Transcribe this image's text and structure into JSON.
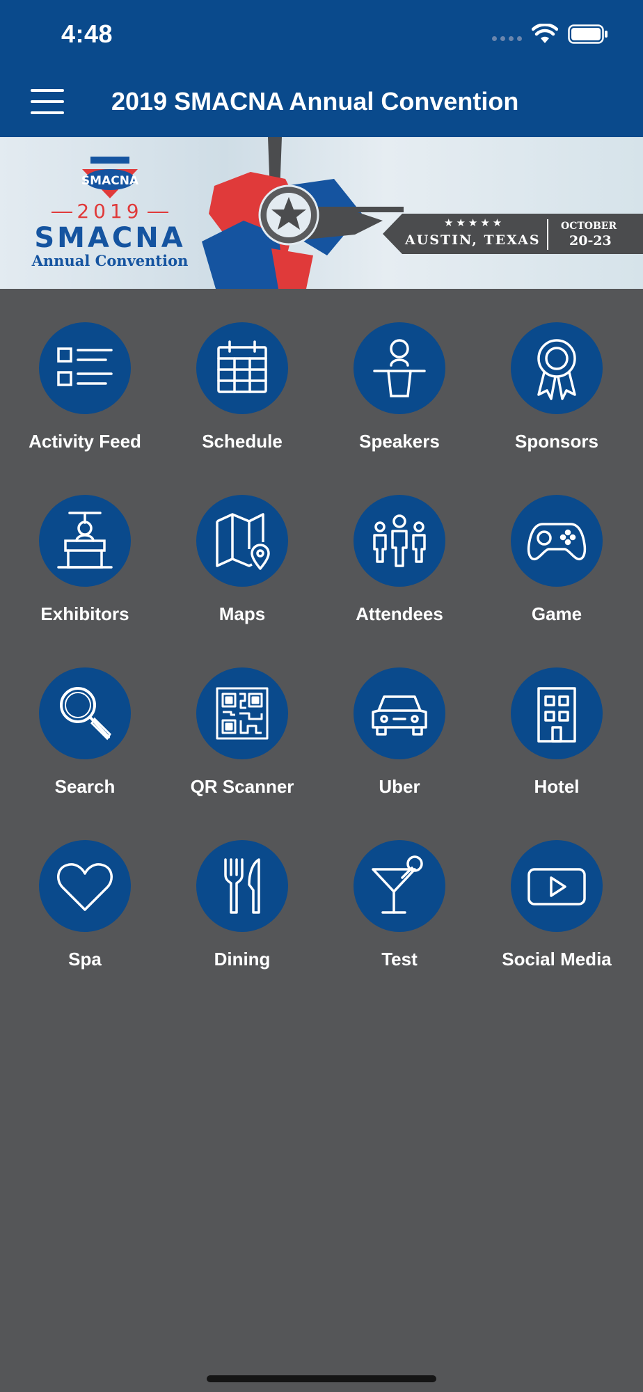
{
  "status_bar": {
    "time": "4:48"
  },
  "app_bar": {
    "title": "2019 SMACNA Annual Convention"
  },
  "banner": {
    "emblem_text": "SMACNA",
    "year": "2019",
    "name": "SMACNA",
    "subtitle": "Annual Convention",
    "stars": "★★★★★",
    "city": "AUSTIN, TEXAS",
    "month": "OCTOBER",
    "dates": "20-23"
  },
  "grid": [
    {
      "label": "Activity Feed",
      "icon": "checklist-icon"
    },
    {
      "label": "Schedule",
      "icon": "calendar-icon"
    },
    {
      "label": "Speakers",
      "icon": "podium-icon"
    },
    {
      "label": "Sponsors",
      "icon": "ribbon-icon"
    },
    {
      "label": "Exhibitors",
      "icon": "booth-icon"
    },
    {
      "label": "Maps",
      "icon": "map-pin-icon"
    },
    {
      "label": "Attendees",
      "icon": "people-icon"
    },
    {
      "label": "Game",
      "icon": "gamepad-icon"
    },
    {
      "label": "Search",
      "icon": "search-icon"
    },
    {
      "label": "QR Scanner",
      "icon": "qr-code-icon"
    },
    {
      "label": "Uber",
      "icon": "car-icon"
    },
    {
      "label": "Hotel",
      "icon": "building-icon"
    },
    {
      "label": "Spa",
      "icon": "heart-icon"
    },
    {
      "label": "Dining",
      "icon": "fork-knife-icon"
    },
    {
      "label": "Test",
      "icon": "cocktail-icon"
    },
    {
      "label": "Social Media",
      "icon": "youtube-icon"
    }
  ],
  "colors": {
    "primary": "#0a4a8c",
    "background": "#555658",
    "text": "#ffffff"
  }
}
